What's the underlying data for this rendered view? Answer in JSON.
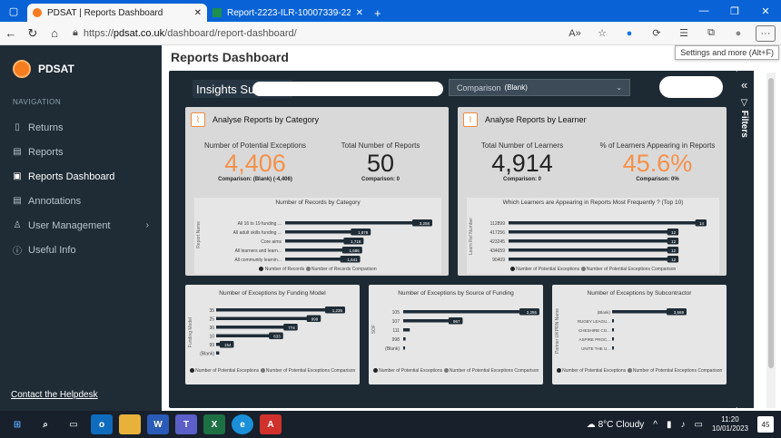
{
  "browser": {
    "tabs": [
      {
        "title": "PDSAT | Reports Dashboard",
        "active": true
      },
      {
        "title": "Report-2223-ILR-10007339-22/...",
        "active": false
      }
    ],
    "url_prefix": "https://",
    "url_domain": "pdsat.co.uk",
    "url_path": "/dashboard/report-dashboard/",
    "tooltip": "Settings and more (Alt+F)"
  },
  "sidebar": {
    "brand": "PDSAT",
    "nav_label": "NAVIGATION",
    "items": [
      {
        "label": "Returns",
        "icon": "document-icon"
      },
      {
        "label": "Reports",
        "icon": "report-icon"
      },
      {
        "label": "Reports Dashboard",
        "icon": "dashboard-icon",
        "active": true
      },
      {
        "label": "Annotations",
        "icon": "annotation-icon"
      },
      {
        "label": "User Management",
        "icon": "users-icon",
        "chevron": true
      },
      {
        "label": "Useful Info",
        "icon": "info-icon"
      }
    ],
    "helpdesk": "Contact the Helpdesk"
  },
  "main": {
    "page_title": "Reports Dashboard",
    "insights_title": "Insights Summ",
    "comparison_label": "Comparison",
    "comparison_value": "(Blank)",
    "filters_label": "Filters"
  },
  "category_card": {
    "title": "Analyse Reports by Category",
    "kpi1": {
      "label": "Number of Potential Exceptions",
      "value": "4,406",
      "comparison": "Comparison: (Blank) (-4,406)"
    },
    "kpi2": {
      "label": "Total Number of Reports",
      "value": "50",
      "comparison": "Comparison: 0"
    }
  },
  "learner_card": {
    "title": "Analyse Reports by Learner",
    "kpi1": {
      "label": "Total Number of Learners",
      "value": "4,914",
      "comparison": "Comparison: 0"
    },
    "kpi2": {
      "label": "% of Learners Appearing in Reports",
      "value": "45.6%",
      "comparison": "Comparison: 0%"
    }
  },
  "colors": {
    "accent": "#f5914a",
    "bar": "#1f2c36",
    "sidebar": "#1f2c36",
    "report_bg": "#1d2a34"
  },
  "chart_data": [
    {
      "type": "bar",
      "title": "Number of Records by Category",
      "ylabel": "Report Name",
      "categories": [
        "All 16 to 19 funding ...",
        "All adult skills funding ...",
        "Core aims",
        "All learners and learn...",
        "All community learnin..."
      ],
      "values": [
        3258,
        1878,
        1718,
        1686,
        1641
      ],
      "legend": [
        "Number of Records",
        "Number of Records Comparison"
      ]
    },
    {
      "type": "bar",
      "title": "Which Learners are Appearing in Reports Most Frequently ? (Top 10)",
      "ylabel": "Learn Ref Number",
      "categories": [
        "112899",
        "417256",
        "423245",
        "434659",
        "90409"
      ],
      "values": [
        14,
        12,
        12,
        12,
        12
      ],
      "legend": [
        "Number of Potential Exceptions",
        "Number of Potential Exceptions Comparison"
      ]
    },
    {
      "type": "bar",
      "title": "Number of Exceptions by Funding Model",
      "ylabel": "Funding Model",
      "categories": [
        "35",
        "25",
        "36",
        "10",
        "99",
        "(Blank)"
      ],
      "values": [
        1235,
        999,
        774,
        633,
        154,
        30
      ],
      "value_labels": [
        "1,235",
        "999",
        "774",
        "633",
        "154",
        ""
      ],
      "legend": [
        "Number of Potential Exceptions",
        "Number of Potential Exceptions Comparison"
      ]
    },
    {
      "type": "bar",
      "title": "Number of Exceptions by Source of Funding",
      "ylabel": "SOF",
      "categories": [
        "105",
        "107",
        "111",
        "998",
        "(Blank)"
      ],
      "values": [
        2255,
        967,
        110,
        40,
        20
      ],
      "value_labels": [
        "2,255",
        "967",
        "",
        "",
        ""
      ],
      "legend": [
        "Number of Potential Exceptions",
        "Number of Potential Exceptions Comparison"
      ]
    },
    {
      "type": "bar",
      "title": "Number of Exceptions by Subcontractor",
      "ylabel": "Partner UKPRN Name",
      "categories": [
        "(Blank)",
        "RUGBY LEAGU...",
        "CHESHIRE CO...",
        "ASPIRE PROC...",
        "UNITE THE U..."
      ],
      "values": [
        3669,
        15,
        12,
        10,
        8
      ],
      "value_labels": [
        "3,669",
        "",
        "",
        "",
        ""
      ],
      "legend": [
        "Number of Potential Exceptions",
        "Number of Potential Exceptions Comparison"
      ]
    }
  ],
  "taskbar": {
    "weather": "8°C Cloudy",
    "time": "11:20",
    "date": "10/01/2023",
    "notifications": "45"
  }
}
